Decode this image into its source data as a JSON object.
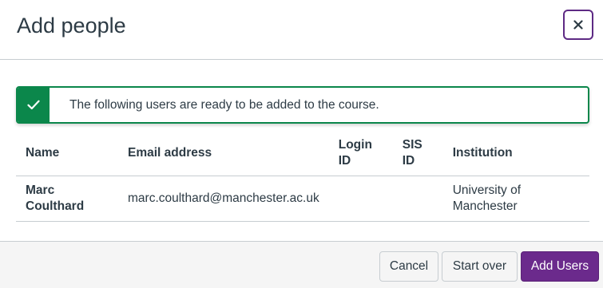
{
  "dialog": {
    "title": "Add people",
    "close_icon": "close-icon"
  },
  "alert": {
    "icon": "check-icon",
    "message": "The following users are ready to be added to the course.",
    "color": "#0b874b"
  },
  "table": {
    "headers": {
      "name": "Name",
      "email": "Email address",
      "login_id": "Login ID",
      "sis_id": "SIS ID",
      "institution": "Institution"
    },
    "rows": [
      {
        "name": "Marc Coulthard",
        "email": "marc.coulthard@manchester.ac.uk",
        "login_id": "",
        "sis_id": "",
        "institution": "University of Manchester"
      }
    ]
  },
  "footer": {
    "cancel_label": "Cancel",
    "start_over_label": "Start over",
    "add_users_label": "Add Users",
    "primary_color": "#6b2a8c"
  }
}
